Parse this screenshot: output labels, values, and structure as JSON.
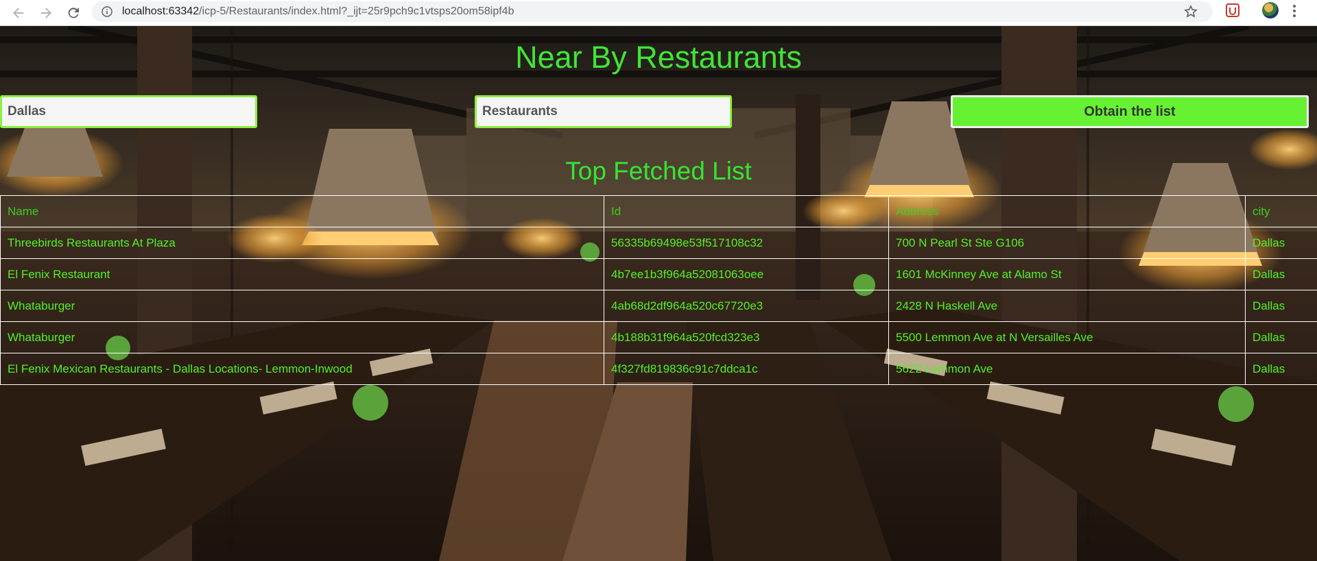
{
  "browser": {
    "url_host": "localhost:63342",
    "url_path": "/icp-5/Restaurants/index.html?_ijt=25r9pch9c1vtsps20om58ipf4b",
    "icons": [
      "back-icon",
      "forward-icon",
      "reload-icon",
      "info-icon",
      "star-icon",
      "extension-icon",
      "profile-avatar",
      "menu-icon"
    ]
  },
  "header": {
    "title": "Near By Restaurants"
  },
  "search": {
    "city_value": "Dallas",
    "category_value": "Restaurants",
    "button_label": "Obtain the list"
  },
  "results": {
    "title": "Top Fetched List",
    "columns": [
      "Name",
      "Id",
      "Address",
      "city"
    ],
    "rows": [
      {
        "name": "Threebirds Restaurants At Plaza",
        "id": "56335b69498e53f517108c32",
        "address": "700 N Pearl St Ste G106",
        "city": "Dallas"
      },
      {
        "name": "El Fenix Restaurant",
        "id": "4b7ee1b3f964a52081063oee",
        "address": "1601 McKinney Ave at Alamo St",
        "city": "Dallas"
      },
      {
        "name": "Whataburger",
        "id": "4ab68d2df964a520c67720e3",
        "address": "2428 N Haskell Ave",
        "city": "Dallas"
      },
      {
        "name": "Whataburger",
        "id": "4b188b31f964a520fcd323e3",
        "address": "5500 Lemmon Ave at N Versailles Ave",
        "city": "Dallas"
      },
      {
        "name": "El Fenix Mexican Restaurants - Dallas Locations- Lemmon-Inwood",
        "id": "4f327fd819836c91c7ddca1c",
        "address": "5622 Lemmon Ave",
        "city": "Dallas"
      }
    ]
  },
  "colors": {
    "title_green": "#3ee636",
    "button_green": "#66f233",
    "input_border": "#8cf040",
    "table_text": "#52f026"
  }
}
